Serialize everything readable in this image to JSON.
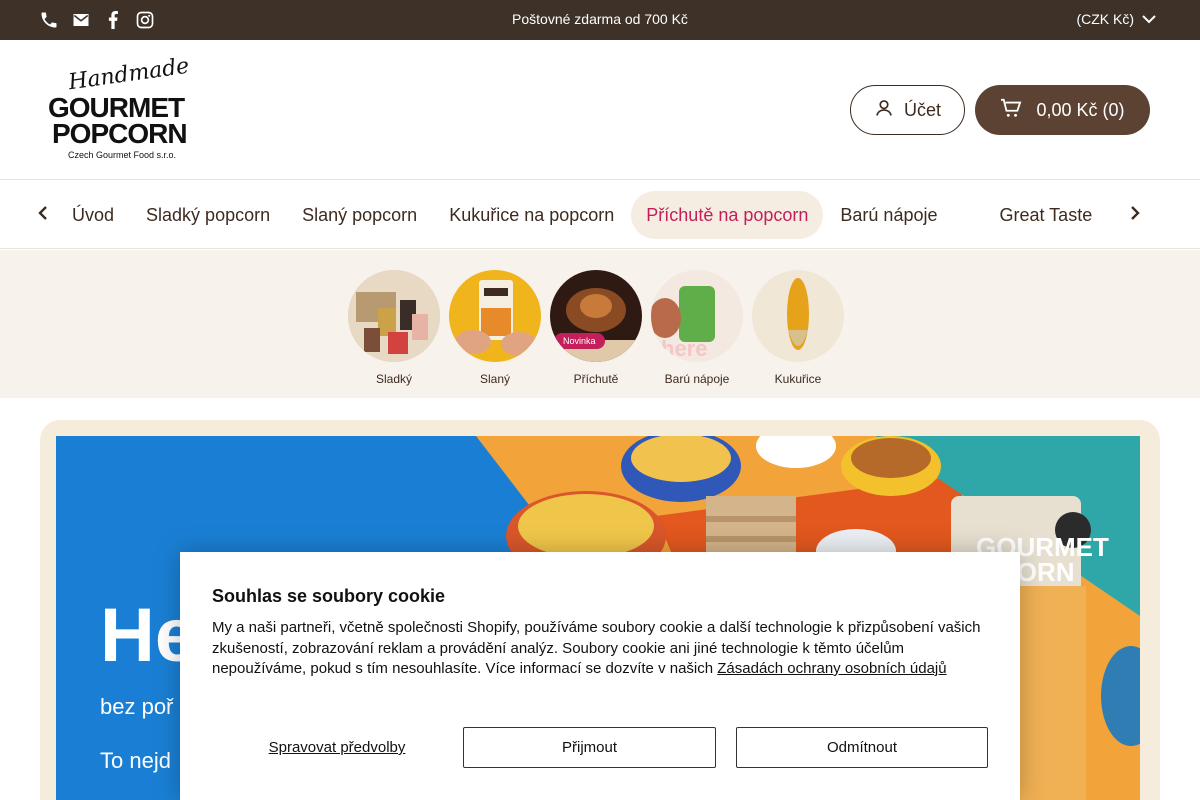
{
  "topbar": {
    "promo": "Poštovné zdarma od 700 Kč",
    "currency": "(CZK Kč)",
    "social_icons": [
      "phone-icon",
      "email-icon",
      "facebook-icon",
      "instagram-icon"
    ]
  },
  "header": {
    "logo": {
      "script": "Handmade",
      "line1": "GOURMET",
      "line2": "POPCORN",
      "tagline": "Czech Gourmet Food s.r.o."
    },
    "account_label": "Účet",
    "cart_label": "0,00 Kč (0)"
  },
  "nav": {
    "items": [
      {
        "label": "Úvod",
        "active": false
      },
      {
        "label": "Sladký popcorn",
        "active": false
      },
      {
        "label": "Slaný popcorn",
        "active": false
      },
      {
        "label": "Kukuřice na popcorn",
        "active": false
      },
      {
        "label": "Příchutě na popcorn",
        "active": true
      },
      {
        "label": "Barú nápoje",
        "active": false
      },
      {
        "label": "Great Taste",
        "active": false
      }
    ]
  },
  "categories": [
    {
      "label": "Sladký"
    },
    {
      "label": "Slaný"
    },
    {
      "label": "Příchutě",
      "badge": "Novinka"
    },
    {
      "label": "Barú nápoje"
    },
    {
      "label": "Kukuřice"
    }
  ],
  "hero": {
    "title_visible": "He",
    "subtitle_visible": "bez poř",
    "line2_visible": "To nejd"
  },
  "cookie": {
    "title": "Souhlas se soubory cookie",
    "text": "My a naši partneři, včetně společnosti Shopify, používáme soubory cookie a další technologie k přizpůsobení vašich zkušeností, zobrazování reklam a provádění analýz. Soubory cookie ani jiné technologie k těmto účelům nepoužíváme, pokud s tím nesouhlasíte. Více informací se dozvíte v našich",
    "link": "Zásadách ochrany osobních údajů",
    "manage": "Spravovat předvolby",
    "accept": "Přijmout",
    "decline": "Odmítnout"
  },
  "colors": {
    "topbar_bg": "#3d3128",
    "cart_bg": "#5b4232",
    "accent": "#c21f5b",
    "active_nav_bg": "#f6ede2",
    "strip_bg": "#f7f2ec",
    "hero_bg": "#1a7fd4"
  }
}
